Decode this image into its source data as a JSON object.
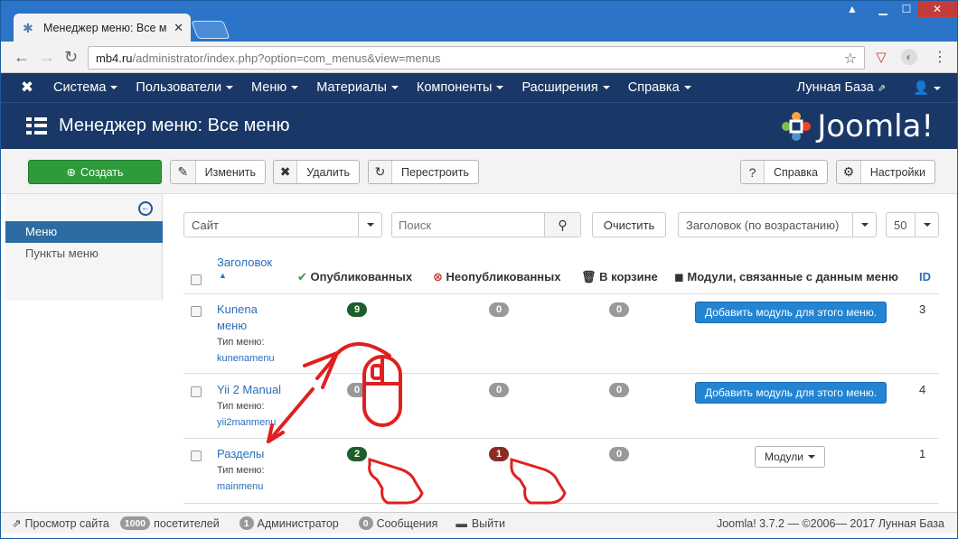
{
  "browser": {
    "tab_title": "Менеджер меню: Все м",
    "url_host": "mb4.ru",
    "url_path": "/administrator/index.php?option=com_menus&view=menus"
  },
  "topnav": {
    "items": [
      "Система",
      "Пользователи",
      "Меню",
      "Материалы",
      "Компоненты",
      "Расширения",
      "Справка"
    ],
    "site_name": "Лунная База"
  },
  "header": {
    "title": "Менеджер меню: Все меню",
    "logo_text": "Joomla!"
  },
  "toolbar": {
    "create": "Создать",
    "edit": "Изменить",
    "delete": "Удалить",
    "rebuild": "Перестроить",
    "help": "Справка",
    "settings": "Настройки"
  },
  "sidebar": {
    "active": "Меню",
    "item": "Пункты меню"
  },
  "filters": {
    "site_select": "Сайт",
    "search_placeholder": "Поиск",
    "clear": "Очистить",
    "sort_select": "Заголовок (по возрастанию)",
    "limit": "50"
  },
  "table": {
    "headers": {
      "title": "Заголовок",
      "published": "Опубликованных",
      "unpublished": "Неопубликованных",
      "trashed": "В корзине",
      "modules": "Модули, связанные с данным меню",
      "id": "ID"
    },
    "type_label": "Тип меню:",
    "add_module": "Добавить модуль для этого меню.",
    "modules_button": "Модули",
    "rows": [
      {
        "title": "Kunena",
        "title2": "меню",
        "type": "kunenamenu",
        "published": "9",
        "unpublished": "0",
        "trashed": "0",
        "id": "3"
      },
      {
        "title": "Yii 2 Manual",
        "title2": "",
        "type": "yii2manmenu",
        "published": "0",
        "unpublished": "0",
        "trashed": "0",
        "id": "4"
      },
      {
        "title": "Разделы",
        "title2": "",
        "type": "mainmenu",
        "published": "2",
        "unpublished": "1",
        "trashed": "0",
        "id": "1"
      }
    ]
  },
  "status": {
    "view_site": "Просмотр сайта",
    "visitors_count": "1000",
    "visitors": "посетителей",
    "admins_count": "1",
    "admins": "Администратор",
    "messages_count": "0",
    "messages": "Сообщения",
    "logout": "Выйти",
    "copyright": "Joomla! 3.7.2 — ©2006— 2017 Лунная База"
  },
  "colors": {
    "nav_bg": "#1a3867",
    "create_green": "#2d9b3a",
    "published_badge": "#1d5e2c",
    "unpublished_badge": "#8c2b25",
    "add_module_blue": "#2384d3",
    "annotation_red": "#e02020"
  }
}
